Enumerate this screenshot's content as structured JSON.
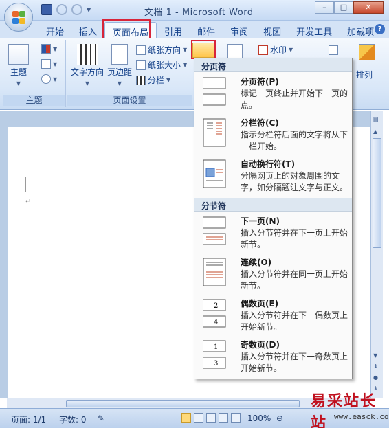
{
  "window": {
    "title": "文档 1 - Microsoft Word",
    "minimize": "–",
    "restore": "□",
    "close": "✕"
  },
  "tabs": [
    "开始",
    "插入",
    "页面布局",
    "引用",
    "邮件",
    "审阅",
    "视图",
    "开发工具",
    "加载项"
  ],
  "active_tab": "页面布局",
  "ribbon": {
    "theme_group": {
      "label": "主题",
      "themes_button": "主题"
    },
    "page_setup_group": {
      "label": "页面设置",
      "text_direction": "文字方向",
      "margins": "页边距",
      "orientation": "纸张方向",
      "size": "纸张大小",
      "columns": "分栏"
    },
    "watermark": "水印",
    "arrange": "排列"
  },
  "breaks_menu": {
    "page_breaks_header": "分页符",
    "section_breaks_header": "分节符",
    "items": [
      {
        "title": "分页符(P)",
        "desc": "标记一页终止并开始下一页的点。",
        "icon": "page-break-icon"
      },
      {
        "title": "分栏符(C)",
        "desc": "指示分栏符后面的文字将从下一栏开始。",
        "icon": "column-break-icon"
      },
      {
        "title": "自动换行符(T)",
        "desc": "分隔网页上的对象周围的文字，如分隔题注文字与正文。",
        "icon": "text-wrapping-icon"
      },
      {
        "title": "下一页(N)",
        "desc": "插入分节符并在下一页上开始新节。",
        "icon": "next-page-icon"
      },
      {
        "title": "连续(O)",
        "desc": "插入分节符并在同一页上开始新节。",
        "icon": "continuous-icon"
      },
      {
        "title": "偶数页(E)",
        "desc": "插入分节符并在下一偶数页上开始新节。",
        "icon": "even-page-icon"
      },
      {
        "title": "奇数页(D)",
        "desc": "插入分节符并在下一奇数页上开始新节。",
        "icon": "odd-page-icon"
      }
    ],
    "even_label_a": "2",
    "even_label_b": "4",
    "odd_label_a": "1",
    "odd_label_b": "3"
  },
  "statusbar": {
    "page": "页面: 1/1",
    "words": "字数: 0",
    "zoom": "100%"
  },
  "watermark_site": "易采站长站",
  "watermark_url": "www.easck.com",
  "paragraph_mark": "↵"
}
